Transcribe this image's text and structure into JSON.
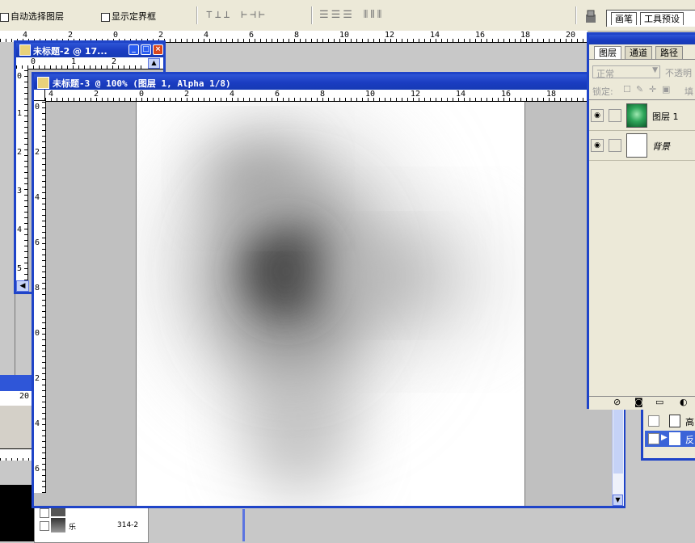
{
  "options_bar": {
    "auto_select_label": "自动选择图层",
    "show_bounds_label": "显示定界框",
    "align_group_1": "⊤⊥⊥ ⊢⊣⊢",
    "align_group_2": "☰☰☰ ⫴⫴⫴",
    "tab_brushes": "画笔",
    "tab_presets": "工具预设"
  },
  "doc2": {
    "title": "未标题-2 @ 17...",
    "ruler_h": [
      "0",
      "1",
      "2"
    ],
    "ruler_v": [
      "0",
      "1",
      "2",
      "3",
      "4",
      "5"
    ]
  },
  "doc3": {
    "title": "未标题-3 @ 100% (图层 1, Alpha 1/8)",
    "ruler_h": [
      "4",
      "2",
      "0",
      "2",
      "4",
      "6",
      "8",
      "10",
      "12",
      "14",
      "16",
      "18"
    ],
    "ruler_v": [
      "0",
      "2",
      "4",
      "6",
      "8",
      "0",
      "2",
      "4",
      "6"
    ]
  },
  "bg_ruler": {
    "top": [
      "4",
      "2",
      "0",
      "2",
      "4",
      "6",
      "8",
      "10",
      "12",
      "14",
      "16",
      "18",
      "20"
    ],
    "left_mini": "20"
  },
  "layers_panel": {
    "tabs": [
      "图层",
      "通道",
      "路径"
    ],
    "blend_mode": "正常",
    "opacity_label": "不透明",
    "lock_label": "锁定:",
    "fill_label": "填",
    "layers": [
      {
        "name": "图层 1"
      },
      {
        "name": "背景"
      }
    ]
  },
  "history_panel": {
    "items": [
      "高",
      "反"
    ]
  },
  "bottom_strip": {
    "item_label": "乐",
    "item_value": "314-2"
  },
  "colors": {
    "titlebar": "#1f44c8",
    "workspace": "#c8c8c8",
    "panel_bg": "#ece9d8"
  }
}
